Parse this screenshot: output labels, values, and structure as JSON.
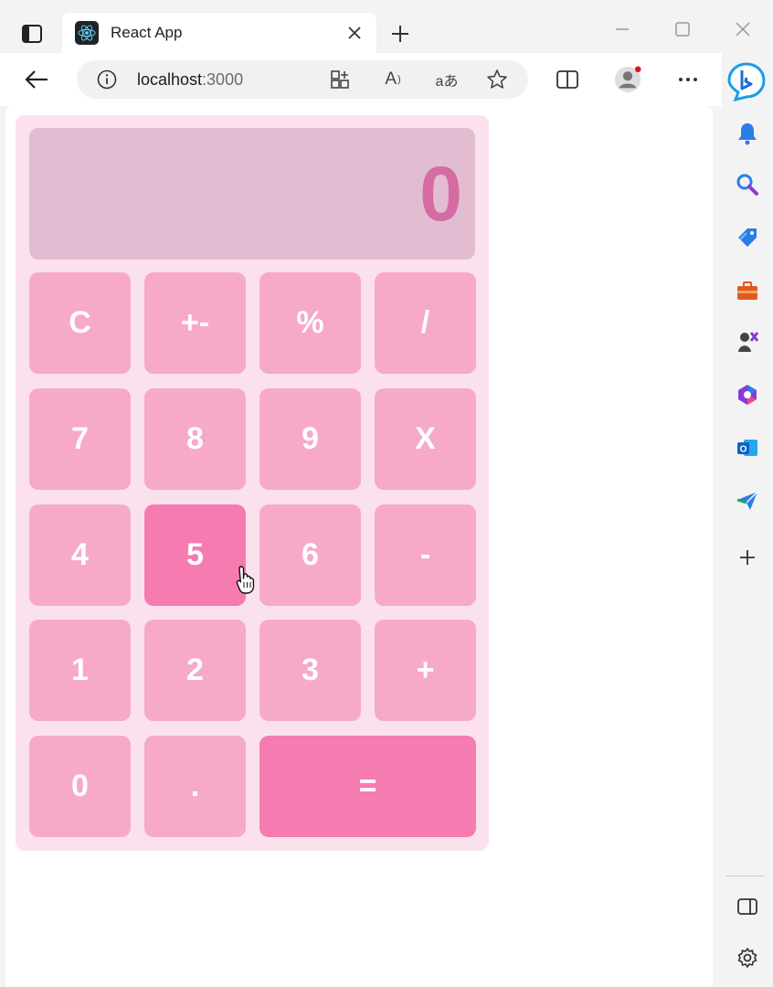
{
  "browser": {
    "tab": {
      "title": "React App"
    },
    "address": {
      "host": "localhost",
      "port": ":3000"
    },
    "icons": {
      "tab_actions": "tab-actions-icon",
      "new_tab": "plus-icon",
      "minimize": "minimize-icon",
      "maximize": "maximize-icon",
      "close": "close-icon",
      "back": "back-arrow-icon",
      "site_info": "info-icon",
      "apps": "apps-icon",
      "read_aloud": "read-aloud-icon",
      "translate": "translate-icon",
      "favorite": "star-icon",
      "split_screen": "split-screen-icon",
      "profile": "profile-icon",
      "more": "more-icon",
      "copilot": "bing-copilot-icon"
    },
    "translate_glyph": "aあ",
    "read_aloud_glyph": "A"
  },
  "sidebar": {
    "items": [
      "bell-icon",
      "search-icon",
      "shopping-tag-icon",
      "tools-icon",
      "games-icon",
      "microsoft365-icon",
      "outlook-icon",
      "send-icon",
      "add-icon"
    ],
    "bottom": [
      "sidebar-toggle-icon",
      "settings-icon"
    ]
  },
  "calculator": {
    "display": "0",
    "keys": {
      "clear": "C",
      "sign": "+-",
      "percent": "%",
      "divide": "/",
      "seven": "7",
      "eight": "8",
      "nine": "9",
      "multiply": "X",
      "four": "4",
      "five": "5",
      "six": "6",
      "subtract": "-",
      "one": "1",
      "two": "2",
      "three": "3",
      "add": "+",
      "zero": "0",
      "decimal": ".",
      "equals": "="
    },
    "colors": {
      "panel": "#fbe1ee",
      "display_bg": "#e2bcd1",
      "display_text": "#d56ba3",
      "key": "#f7a9ca",
      "key_active": "#f67bb0",
      "key_text": "#ffffff"
    }
  }
}
